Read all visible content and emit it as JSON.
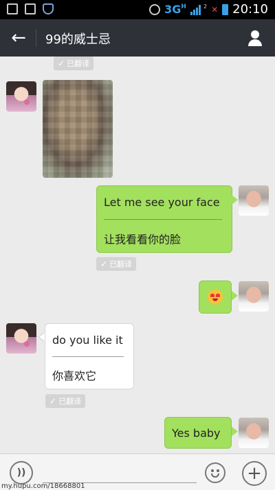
{
  "status_bar": {
    "network": "3G",
    "network_sub": "H",
    "sim_no_signal": "2",
    "no_signal_mark": "✕",
    "time": "20:10"
  },
  "header": {
    "back_icon": "arrow-left-icon",
    "title": "99的威士忌",
    "profile_icon": "person-icon"
  },
  "chat": {
    "translated_label": "已翻译",
    "messages": [
      {
        "sender": "contact",
        "type": "image",
        "description": "blurred-photo"
      },
      {
        "sender": "me",
        "type": "text",
        "text": "Let me see your face",
        "translation": "让我看看你的脸"
      },
      {
        "sender": "me",
        "type": "emoji",
        "emoji": "heart-eyes"
      },
      {
        "sender": "contact",
        "type": "text",
        "text": "do you like it",
        "translation": "你喜欢它"
      },
      {
        "sender": "me",
        "type": "text",
        "text": "Yes baby"
      }
    ]
  },
  "input_bar": {
    "voice_icon": "voice-icon",
    "emoji_icon": "smiley-icon",
    "more_icon": "plus-icon",
    "text_value": ""
  },
  "watermark": "my.hupu.com/18668801",
  "colors": {
    "title_bar": "#2e3238",
    "chat_bg": "#ebebeb",
    "my_bubble": "#a3e05e",
    "their_bubble": "#ffffff"
  }
}
